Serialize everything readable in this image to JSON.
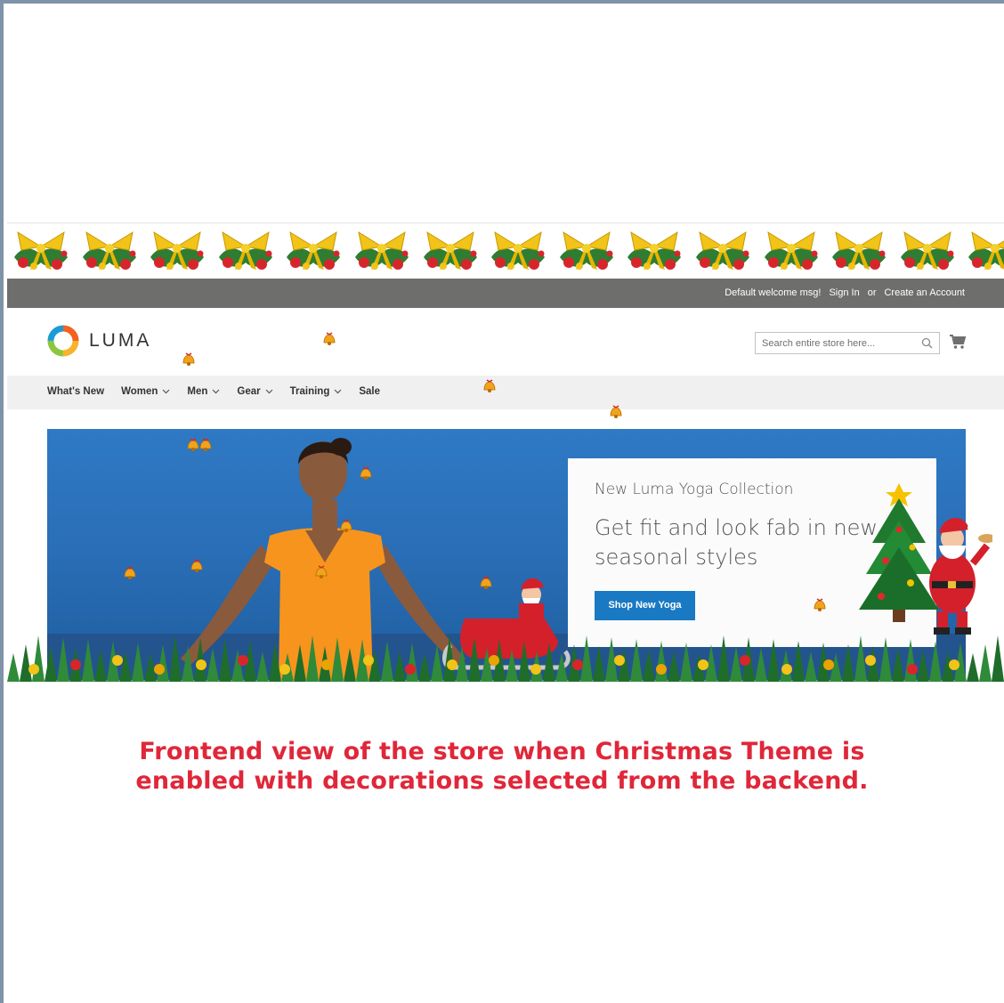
{
  "header": {
    "welcome": "Default welcome msg!",
    "sign_in": "Sign In",
    "or": "or",
    "create_account": "Create an Account"
  },
  "logo": {
    "text": "LUMA",
    "icon": "luma-logo-icon"
  },
  "search": {
    "placeholder": "Search entire store here...",
    "icon": "search-icon"
  },
  "cart": {
    "icon": "cart-icon"
  },
  "nav": {
    "items": [
      {
        "label": "What's New",
        "has_dropdown": false
      },
      {
        "label": "Women",
        "has_dropdown": true
      },
      {
        "label": "Men",
        "has_dropdown": true
      },
      {
        "label": "Gear",
        "has_dropdown": true
      },
      {
        "label": "Training",
        "has_dropdown": true
      },
      {
        "label": "Sale",
        "has_dropdown": false
      }
    ]
  },
  "hero": {
    "subtitle": "New Luma Yoga Collection",
    "headline": "Get fit and look fab in new seasonal styles",
    "cta": "Shop New Yoga"
  },
  "decorations": {
    "garland": "christmas-bow-garland",
    "items": [
      "christmas-tree-icon",
      "santa-icon",
      "sleigh-icon",
      "bell-icon"
    ]
  },
  "caption": {
    "line1": "Frontend view of the store when Christmas Theme is",
    "line2": "enabled with decorations selected from the backend."
  },
  "colors": {
    "topbar": "#6e6e6c",
    "nav_bg": "#f0f0f0",
    "cta": "#1979c3",
    "caption": "#e0273a",
    "frame": "#7f93a8"
  }
}
